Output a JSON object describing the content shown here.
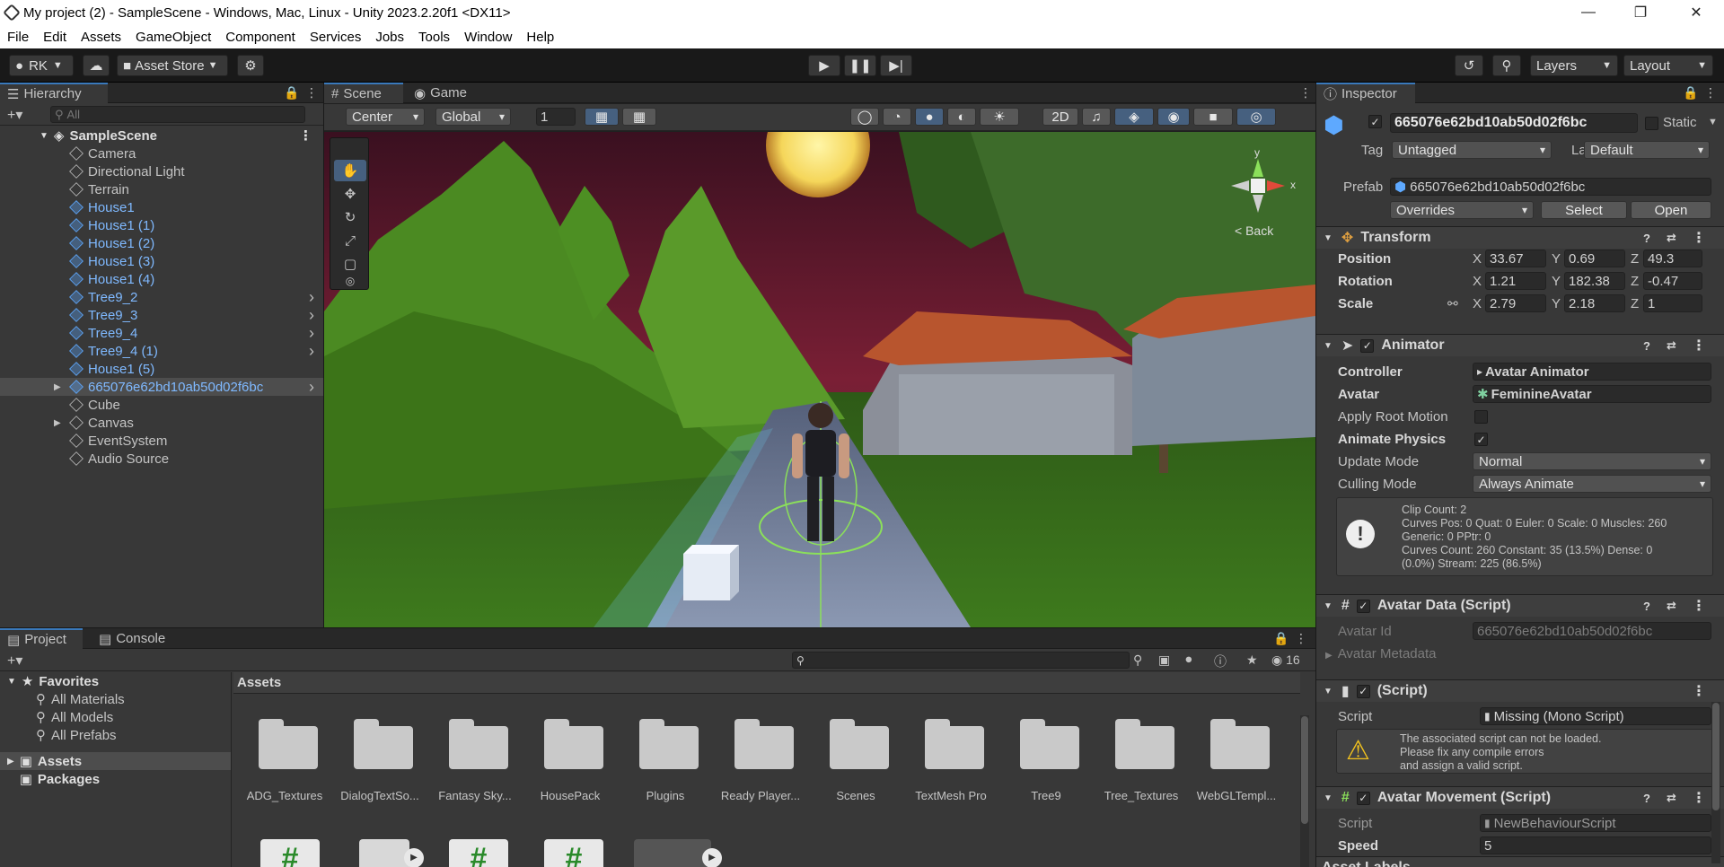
{
  "window": {
    "title": "My project (2) - SampleScene - Windows, Mac, Linux - Unity 2023.2.20f1 <DX11>"
  },
  "menu": [
    "File",
    "Edit",
    "Assets",
    "GameObject",
    "Component",
    "Services",
    "Jobs",
    "Tools",
    "Window",
    "Help"
  ],
  "toolbar": {
    "account": "RK",
    "asset_store": "Asset Store",
    "layers": "Layers",
    "layout": "Layout"
  },
  "hierarchy": {
    "tab": "Hierarchy",
    "search_placeholder": "All",
    "scene": "SampleScene",
    "items": [
      {
        "label": "Camera",
        "prefab": false
      },
      {
        "label": "Directional Light",
        "prefab": false
      },
      {
        "label": "Terrain",
        "prefab": false
      },
      {
        "label": "House1",
        "prefab": true
      },
      {
        "label": "House1 (1)",
        "prefab": true
      },
      {
        "label": "House1 (2)",
        "prefab": true
      },
      {
        "label": "House1 (3)",
        "prefab": true
      },
      {
        "label": "House1 (4)",
        "prefab": true
      },
      {
        "label": "Tree9_2",
        "prefab": true
      },
      {
        "label": "Tree9_3",
        "prefab": true
      },
      {
        "label": "Tree9_4",
        "prefab": true
      },
      {
        "label": "Tree9_4 (1)",
        "prefab": true
      },
      {
        "label": "House1 (5)",
        "prefab": true
      },
      {
        "label": "665076e62bd10ab50d02f6bc",
        "prefab": true
      },
      {
        "label": "Cube",
        "prefab": false
      },
      {
        "label": "Canvas",
        "prefab": false
      },
      {
        "label": "EventSystem",
        "prefab": false
      },
      {
        "label": "Audio Source",
        "prefab": false
      }
    ]
  },
  "scene_view": {
    "tab_scene": "Scene",
    "tab_game": "Game",
    "pivot": "Center",
    "space": "Global",
    "grid_size": "1",
    "mode_2d": "2D",
    "gizmo_back": "< Back",
    "gizmo_x": "x",
    "gizmo_y": "y"
  },
  "project": {
    "tab_project": "Project",
    "tab_console": "Console",
    "hidden_count": "16",
    "favorites_label": "Favorites",
    "favorites": [
      "All Materials",
      "All Models",
      "All Prefabs"
    ],
    "roots": [
      "Assets",
      "Packages"
    ],
    "breadcrumb": "Assets",
    "folders": [
      "ADG_Textures",
      "DialogTextSo...",
      "Fantasy Sky...",
      "HousePack",
      "Plugins",
      "Ready Player...",
      "Scenes",
      "TextMesh Pro",
      "Tree9",
      "Tree_Textures",
      "WebGLTempl..."
    ]
  },
  "inspector": {
    "tab": "Inspector",
    "object_name": "665076e62bd10ab50d02f6bc",
    "static_label": "Static",
    "tag_label": "Tag",
    "tag_value": "Untagged",
    "layer_label": "Layer",
    "layer_value": "Default",
    "prefab_label": "Prefab",
    "prefab_value": "665076e62bd10ab50d02f6bc",
    "overrides": "Overrides",
    "select": "Select",
    "open": "Open",
    "transform": {
      "title": "Transform",
      "position": {
        "label": "Position",
        "x": "33.67",
        "y": "0.69",
        "z": "49.3"
      },
      "rotation": {
        "label": "Rotation",
        "x": "1.21",
        "y": "182.38",
        "z": "-0.47"
      },
      "scale": {
        "label": "Scale",
        "x": "2.79",
        "y": "2.18",
        "z": "1"
      }
    },
    "axis": {
      "x": "X",
      "y": "Y",
      "z": "Z"
    },
    "animator": {
      "title": "Animator",
      "controller_label": "Controller",
      "controller_value": "Avatar Animator",
      "avatar_label": "Avatar",
      "avatar_value": "FeminineAvatar",
      "apply_root_label": "Apply Root Motion",
      "animate_physics_label": "Animate Physics",
      "update_mode_label": "Update Mode",
      "update_mode_value": "Normal",
      "culling_mode_label": "Culling Mode",
      "culling_mode_value": "Always Animate",
      "info": [
        "Clip Count: 2",
        "Curves Pos: 0 Quat: 0 Euler: 0 Scale: 0 Muscles: 260",
        "Generic: 0 PPtr: 0",
        "Curves Count: 260 Constant: 35 (13.5%) Dense: 0",
        "(0.0%) Stream: 225 (86.5%)"
      ]
    },
    "avatar_data": {
      "title": "Avatar Data (Script)",
      "avatar_id_label": "Avatar Id",
      "avatar_id_value": "665076e62bd10ab50d02f6bc",
      "metadata_label": "Avatar Metadata"
    },
    "missing": {
      "title": "(Script)",
      "script_label": "Script",
      "script_value": "Missing (Mono Script)",
      "warning": [
        "The associated script can not be loaded.",
        "Please fix any compile errors",
        "and assign a valid script."
      ]
    },
    "movement": {
      "title": "Avatar Movement (Script)",
      "script_label": "Script",
      "script_value": "NewBehaviourScript",
      "speed_label": "Speed",
      "speed_value": "5"
    },
    "asset_labels": "Asset Labels"
  }
}
